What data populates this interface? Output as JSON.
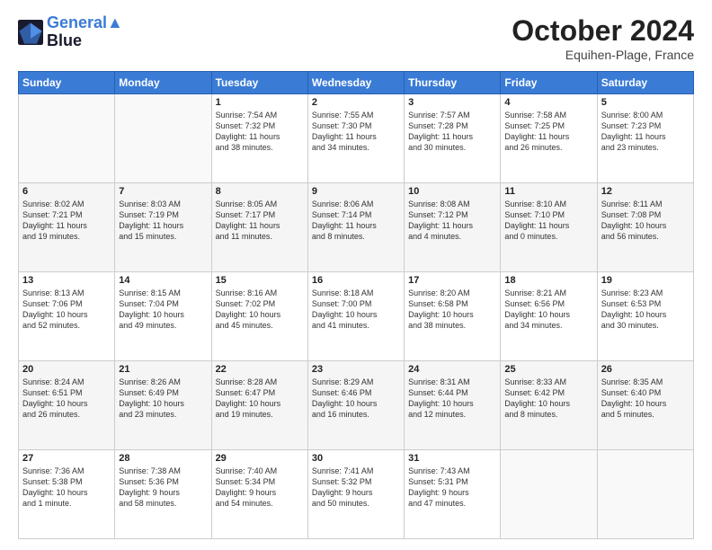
{
  "header": {
    "logo_line1": "General",
    "logo_line2": "Blue",
    "month": "October 2024",
    "location": "Equihen-Plage, France"
  },
  "days_of_week": [
    "Sunday",
    "Monday",
    "Tuesday",
    "Wednesday",
    "Thursday",
    "Friday",
    "Saturday"
  ],
  "weeks": [
    [
      {
        "day": "",
        "info": ""
      },
      {
        "day": "",
        "info": ""
      },
      {
        "day": "1",
        "info": "Sunrise: 7:54 AM\nSunset: 7:32 PM\nDaylight: 11 hours\nand 38 minutes."
      },
      {
        "day": "2",
        "info": "Sunrise: 7:55 AM\nSunset: 7:30 PM\nDaylight: 11 hours\nand 34 minutes."
      },
      {
        "day": "3",
        "info": "Sunrise: 7:57 AM\nSunset: 7:28 PM\nDaylight: 11 hours\nand 30 minutes."
      },
      {
        "day": "4",
        "info": "Sunrise: 7:58 AM\nSunset: 7:25 PM\nDaylight: 11 hours\nand 26 minutes."
      },
      {
        "day": "5",
        "info": "Sunrise: 8:00 AM\nSunset: 7:23 PM\nDaylight: 11 hours\nand 23 minutes."
      }
    ],
    [
      {
        "day": "6",
        "info": "Sunrise: 8:02 AM\nSunset: 7:21 PM\nDaylight: 11 hours\nand 19 minutes."
      },
      {
        "day": "7",
        "info": "Sunrise: 8:03 AM\nSunset: 7:19 PM\nDaylight: 11 hours\nand 15 minutes."
      },
      {
        "day": "8",
        "info": "Sunrise: 8:05 AM\nSunset: 7:17 PM\nDaylight: 11 hours\nand 11 minutes."
      },
      {
        "day": "9",
        "info": "Sunrise: 8:06 AM\nSunset: 7:14 PM\nDaylight: 11 hours\nand 8 minutes."
      },
      {
        "day": "10",
        "info": "Sunrise: 8:08 AM\nSunset: 7:12 PM\nDaylight: 11 hours\nand 4 minutes."
      },
      {
        "day": "11",
        "info": "Sunrise: 8:10 AM\nSunset: 7:10 PM\nDaylight: 11 hours\nand 0 minutes."
      },
      {
        "day": "12",
        "info": "Sunrise: 8:11 AM\nSunset: 7:08 PM\nDaylight: 10 hours\nand 56 minutes."
      }
    ],
    [
      {
        "day": "13",
        "info": "Sunrise: 8:13 AM\nSunset: 7:06 PM\nDaylight: 10 hours\nand 52 minutes."
      },
      {
        "day": "14",
        "info": "Sunrise: 8:15 AM\nSunset: 7:04 PM\nDaylight: 10 hours\nand 49 minutes."
      },
      {
        "day": "15",
        "info": "Sunrise: 8:16 AM\nSunset: 7:02 PM\nDaylight: 10 hours\nand 45 minutes."
      },
      {
        "day": "16",
        "info": "Sunrise: 8:18 AM\nSunset: 7:00 PM\nDaylight: 10 hours\nand 41 minutes."
      },
      {
        "day": "17",
        "info": "Sunrise: 8:20 AM\nSunset: 6:58 PM\nDaylight: 10 hours\nand 38 minutes."
      },
      {
        "day": "18",
        "info": "Sunrise: 8:21 AM\nSunset: 6:56 PM\nDaylight: 10 hours\nand 34 minutes."
      },
      {
        "day": "19",
        "info": "Sunrise: 8:23 AM\nSunset: 6:53 PM\nDaylight: 10 hours\nand 30 minutes."
      }
    ],
    [
      {
        "day": "20",
        "info": "Sunrise: 8:24 AM\nSunset: 6:51 PM\nDaylight: 10 hours\nand 26 minutes."
      },
      {
        "day": "21",
        "info": "Sunrise: 8:26 AM\nSunset: 6:49 PM\nDaylight: 10 hours\nand 23 minutes."
      },
      {
        "day": "22",
        "info": "Sunrise: 8:28 AM\nSunset: 6:47 PM\nDaylight: 10 hours\nand 19 minutes."
      },
      {
        "day": "23",
        "info": "Sunrise: 8:29 AM\nSunset: 6:46 PM\nDaylight: 10 hours\nand 16 minutes."
      },
      {
        "day": "24",
        "info": "Sunrise: 8:31 AM\nSunset: 6:44 PM\nDaylight: 10 hours\nand 12 minutes."
      },
      {
        "day": "25",
        "info": "Sunrise: 8:33 AM\nSunset: 6:42 PM\nDaylight: 10 hours\nand 8 minutes."
      },
      {
        "day": "26",
        "info": "Sunrise: 8:35 AM\nSunset: 6:40 PM\nDaylight: 10 hours\nand 5 minutes."
      }
    ],
    [
      {
        "day": "27",
        "info": "Sunrise: 7:36 AM\nSunset: 5:38 PM\nDaylight: 10 hours\nand 1 minute."
      },
      {
        "day": "28",
        "info": "Sunrise: 7:38 AM\nSunset: 5:36 PM\nDaylight: 9 hours\nand 58 minutes."
      },
      {
        "day": "29",
        "info": "Sunrise: 7:40 AM\nSunset: 5:34 PM\nDaylight: 9 hours\nand 54 minutes."
      },
      {
        "day": "30",
        "info": "Sunrise: 7:41 AM\nSunset: 5:32 PM\nDaylight: 9 hours\nand 50 minutes."
      },
      {
        "day": "31",
        "info": "Sunrise: 7:43 AM\nSunset: 5:31 PM\nDaylight: 9 hours\nand 47 minutes."
      },
      {
        "day": "",
        "info": ""
      },
      {
        "day": "",
        "info": ""
      }
    ]
  ]
}
